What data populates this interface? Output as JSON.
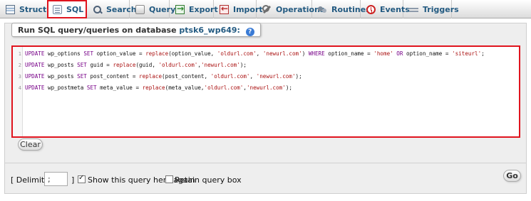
{
  "tabs": [
    {
      "label": "Structure",
      "icon": "structure-icon"
    },
    {
      "label": "SQL",
      "icon": "sql-icon",
      "active": true
    },
    {
      "label": "Search",
      "icon": "search-icon"
    },
    {
      "label": "Query",
      "icon": "query-icon"
    },
    {
      "label": "Export",
      "icon": "export-icon"
    },
    {
      "label": "Import",
      "icon": "import-icon"
    },
    {
      "label": "Operations",
      "icon": "operations-icon"
    },
    {
      "label": "Routines",
      "icon": "routines-icon"
    },
    {
      "label": "Events",
      "icon": "events-icon"
    },
    {
      "label": "Triggers",
      "icon": "triggers-icon"
    }
  ],
  "panel": {
    "legend_prefix": "Run SQL query/queries on database ",
    "database": "ptsk6_wp649:",
    "help_icon": "?"
  },
  "editor": {
    "lines": [
      {
        "num": "1",
        "code": "UPDATE wp_options SET option_value = replace(option_value, 'oldurl.com', 'newurl.com') WHERE option_name = 'home' OR option_name = 'siteurl';"
      },
      {
        "num": "2",
        "code": "UPDATE wp_posts SET guid = replace(guid, 'oldurl.com','newurl.com');"
      },
      {
        "num": "3",
        "code": "UPDATE wp_posts SET post_content = replace(post_content, 'oldurl.com', 'newurl.com');"
      },
      {
        "num": "4",
        "code": "UPDATE wp_postmeta SET meta_value = replace(meta_value,'oldurl.com','newurl.com');"
      }
    ]
  },
  "buttons": {
    "clear": "Clear",
    "go": "Go"
  },
  "options": {
    "delimiter_open": "[ Delimiter",
    "delimiter_value": ";",
    "delimiter_close": "]",
    "show_query": "Show this query here again",
    "show_query_checked": true,
    "retain_box": "Retain query box",
    "retain_box_checked": false
  },
  "colors": {
    "link": "#235a81",
    "highlight_border": "#e0141e",
    "sql_keyword": "#770088",
    "sql_string": "#aa1111"
  }
}
